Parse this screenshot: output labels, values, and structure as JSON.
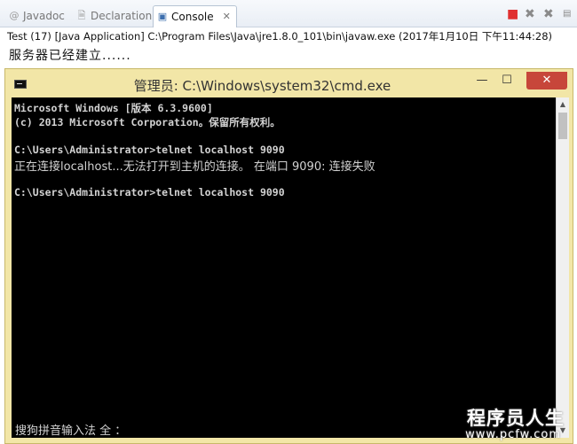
{
  "tabs": [
    {
      "label": "Javadoc",
      "icon": "at-icon"
    },
    {
      "label": "Declaration",
      "icon": "declaration-icon"
    },
    {
      "label": "Console",
      "icon": "console-icon",
      "active": true
    }
  ],
  "console_view": {
    "launch_info": "Test (17) [Java Application] C:\\Program Files\\Java\\jre1.8.0_101\\bin\\javaw.exe (2017年1月10日 下午11:44:28)",
    "output": "服务器已经建立......"
  },
  "cmd": {
    "title": "管理员: C:\\Windows\\system32\\cmd.exe",
    "lines": [
      "Microsoft Windows [版本 6.3.9600]",
      "(c) 2013 Microsoft Corporation。保留所有权利。",
      "",
      "C:\\Users\\Administrator>telnet localhost 9090",
      "正在连接localhost...无法打开到主机的连接。 在端口 9090: 连接失败",
      "",
      "C:\\Users\\Administrator>telnet localhost 9090"
    ],
    "ime_status": "搜狗拼音输入法 全 ："
  },
  "watermark": {
    "line1": "程序员人生",
    "line2": "www.pcfw.com"
  },
  "colors": {
    "cmd_frame": "#f2e6a7",
    "terminate": "#e03030",
    "close_button": "#c7463a"
  }
}
